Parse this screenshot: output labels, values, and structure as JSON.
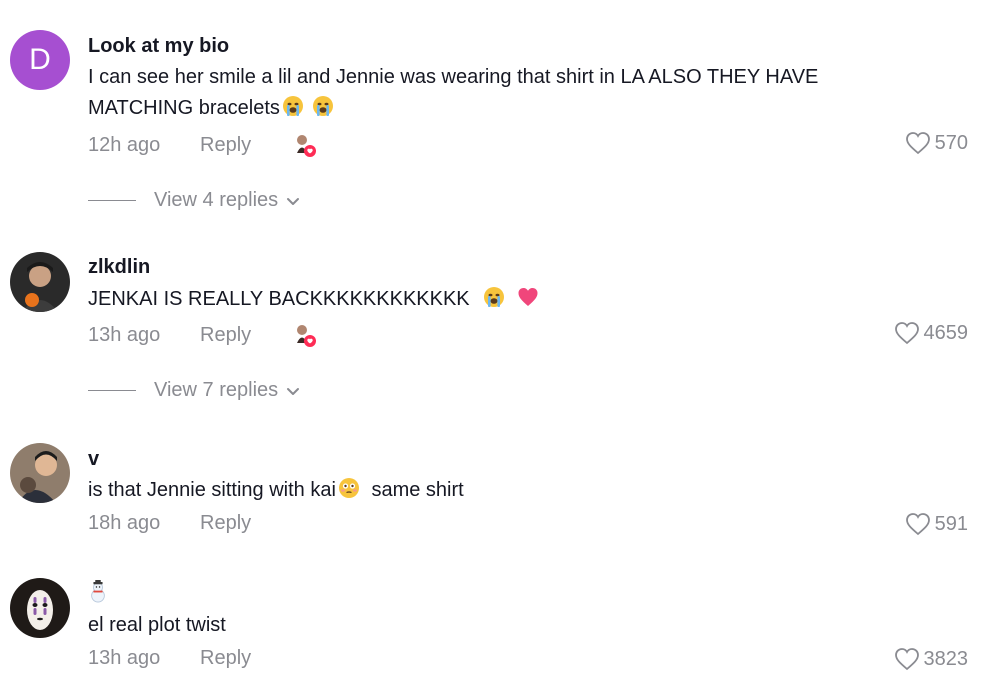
{
  "comments": [
    {
      "avatar_letter": "D",
      "username": "Look at my bio",
      "text": "I can see her smile a lil and Jennie was wearing that shirt in LA ALSO THEY HAVE MATCHING bracelets",
      "time": "12h ago",
      "reply_label": "Reply",
      "likes": "570",
      "view_replies": "View 4 replies"
    },
    {
      "username": "zlkdlin",
      "text": "JENKAI IS REALLY BACKKKKKKKKKKKK",
      "time": "13h ago",
      "reply_label": "Reply",
      "likes": "4659",
      "view_replies": "View 7 replies"
    },
    {
      "username": "v",
      "text_before": "is that Jennie sitting with kai",
      "text_after": "same shirt",
      "time": "18h ago",
      "reply_label": "Reply",
      "likes": "591"
    },
    {
      "username": "",
      "text": "el real plot twist",
      "time": "13h ago",
      "reply_label": "Reply",
      "likes": "3823"
    }
  ],
  "colors": {
    "avatar_letter_bg": "#a64fd1",
    "muted": "#8a8b91",
    "text": "#161823",
    "heart_badge": "#fe2c55"
  },
  "icons": [
    "heart-outline-icon",
    "chevron-down-icon",
    "creator-liked-badge-icon",
    "loudly-crying-face-emoji",
    "pink-heart-emoji",
    "flushed-face-emoji",
    "snowman-emoji"
  ]
}
